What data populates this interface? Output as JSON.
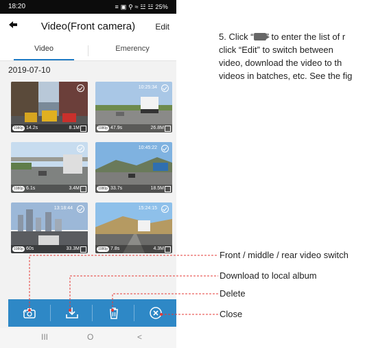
{
  "status_bar": {
    "time": "18:20",
    "system": "≡ ▣ ⚲ ≈ ☳ ☳ 25%"
  },
  "header": {
    "back_icon": "back-arrow-icon",
    "title": "Video(Front camera)",
    "edit_label": "Edit"
  },
  "tabs": [
    {
      "label": "Video",
      "active": true
    },
    {
      "label": "Emerency",
      "active": false
    }
  ],
  "date": "2019-07-10",
  "thumbnails": [
    {
      "timestamp": "",
      "resolution": "1080p",
      "duration": "14.2s",
      "size": "8.1M",
      "scene": "city-street"
    },
    {
      "timestamp": "10:25:34",
      "resolution": "1080p",
      "duration": "47.9s",
      "size": "26.8M",
      "scene": "highway-truck"
    },
    {
      "timestamp": "",
      "resolution": "1080p",
      "duration": "6.1s",
      "size": "3.4M",
      "scene": "highway-bridge"
    },
    {
      "timestamp": "10:45:22",
      "resolution": "1080p",
      "duration": "33.7s",
      "size": "18.5M",
      "scene": "mountain-road"
    },
    {
      "timestamp": "13:18:44",
      "resolution": "1080p",
      "duration": "60s",
      "size": "33.3M",
      "scene": "city-skyline"
    },
    {
      "timestamp": "15:24:15",
      "resolution": "1080p",
      "duration": "7.8s",
      "size": "4.3M",
      "scene": "coastal-rv"
    }
  ],
  "toolbar": [
    {
      "name": "camera-switch",
      "icon": "camera-switch-icon"
    },
    {
      "name": "download",
      "icon": "download-icon"
    },
    {
      "name": "delete",
      "icon": "trash-icon"
    },
    {
      "name": "close",
      "icon": "close-circle-icon"
    }
  ],
  "nav_bar": {
    "recent": "III",
    "home": "O",
    "back": "<"
  },
  "instructions": {
    "line1_before": "5. Click “",
    "line1_after": "” to enter the list of r",
    "line2": "click “Edit” to switch between",
    "line3": "video, download the video to th",
    "line4": "videos in batches, etc. See the fig"
  },
  "callouts": {
    "switch": "Front / middle / rear video switch",
    "download": "Download to local album",
    "delete": "Delete",
    "close": "Close"
  },
  "colors": {
    "toolbar": "#2e88c6",
    "callout_line": "#e53935",
    "tab_indicator": "#1f7bc4"
  }
}
